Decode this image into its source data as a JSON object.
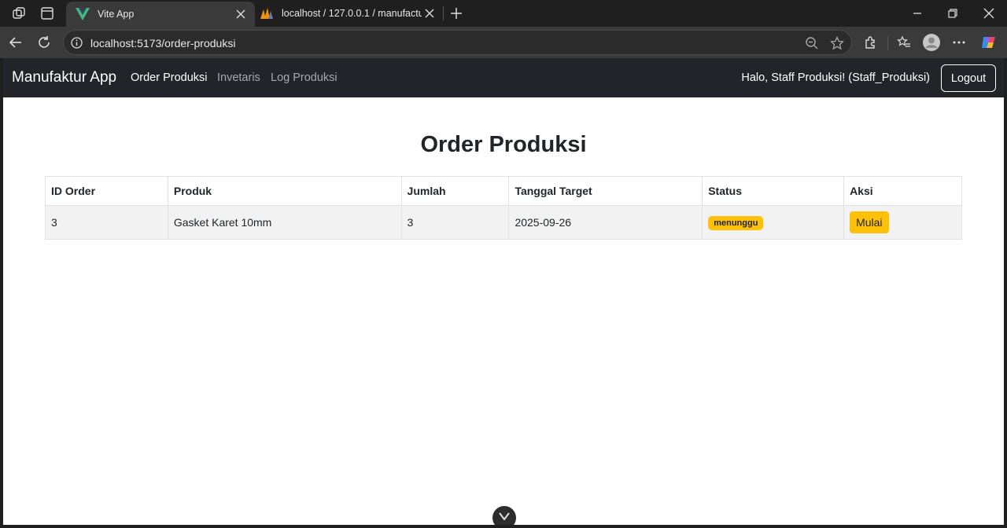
{
  "browser": {
    "tabs": [
      {
        "title": "Vite App",
        "active": true
      },
      {
        "title": "localhost / 127.0.0.1 / manufactur",
        "active": false
      }
    ],
    "url": "localhost:5173/order-produksi"
  },
  "app": {
    "brand": "Manufaktur App",
    "nav": [
      {
        "label": "Order Produksi",
        "active": true
      },
      {
        "label": "Invetaris",
        "active": false
      },
      {
        "label": "Log Produksi",
        "active": false
      }
    ],
    "greeting": "Halo, Staff Produksi! (Staff_Produksi)",
    "logout_label": "Logout"
  },
  "page": {
    "title": "Order Produksi",
    "table": {
      "headers": [
        "ID Order",
        "Produk",
        "Jumlah",
        "Tanggal Target",
        "Status",
        "Aksi"
      ],
      "rows": [
        {
          "id": "3",
          "produk": "Gasket Karet 10mm",
          "jumlah": "3",
          "tanggal_target": "2025-09-26",
          "status": "menunggu",
          "aksi": "Mulai"
        }
      ]
    }
  },
  "colors": {
    "navbar_bg": "#212529",
    "warning": "#ffc107",
    "row_bg": "#f2f2f2"
  },
  "icons": {
    "tab1_favicon": "vue-logo-icon",
    "tab2_favicon": "phpmyadmin-icon",
    "devtools": "vue-devtools-icon"
  }
}
